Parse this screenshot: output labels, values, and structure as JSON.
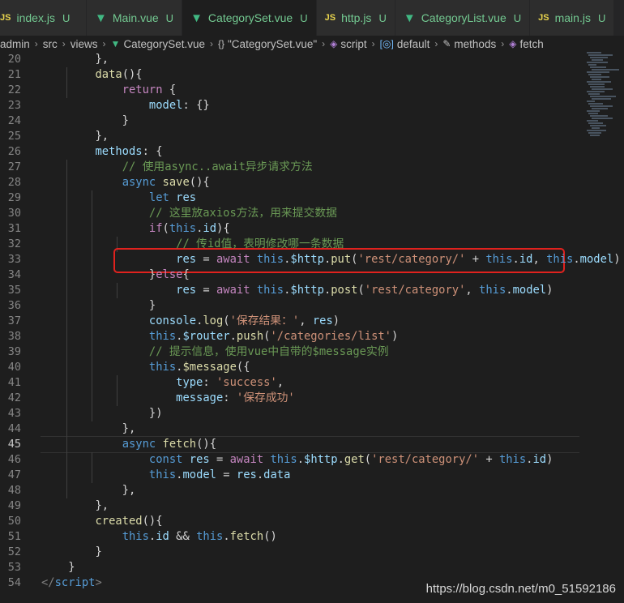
{
  "tabs": [
    {
      "icon": "JS",
      "icon_type": "js",
      "label": "index.js",
      "status": "U"
    },
    {
      "icon": "▼",
      "icon_type": "vue",
      "label": "Main.vue",
      "status": "U"
    },
    {
      "icon": "▼",
      "icon_type": "vue",
      "label": "CategorySet.vue",
      "status": "U",
      "active": true
    },
    {
      "icon": "JS",
      "icon_type": "js",
      "label": "http.js",
      "status": "U"
    },
    {
      "icon": "▼",
      "icon_type": "vue",
      "label": "CategoryList.vue",
      "status": "U"
    },
    {
      "icon": "JS",
      "icon_type": "js",
      "label": "main.js",
      "status": "U"
    }
  ],
  "breadcrumb": {
    "admin": "admin",
    "src": "src",
    "views": "views",
    "file": "CategorySet.vue",
    "component": "\"CategorySet.vue\"",
    "script": "script",
    "default": "default",
    "methods": "methods",
    "fetch": "fetch"
  },
  "current_line": 45,
  "lines": [
    {
      "n": "20",
      "tokens": [
        [
          "t-plain",
          "        },"
        ]
      ]
    },
    {
      "n": "21",
      "tokens": [
        [
          "t-plain",
          "        "
        ],
        [
          "t-fn",
          "data"
        ],
        [
          "t-plain",
          "(){"
        ]
      ]
    },
    {
      "n": "22",
      "tokens": [
        [
          "t-plain",
          "            "
        ],
        [
          "t-ctrl",
          "return"
        ],
        [
          "t-plain",
          " {"
        ]
      ]
    },
    {
      "n": "23",
      "tokens": [
        [
          "t-plain",
          "                "
        ],
        [
          "t-prop",
          "model"
        ],
        [
          "t-plain",
          ": {}"
        ]
      ]
    },
    {
      "n": "24",
      "tokens": [
        [
          "t-plain",
          "            }"
        ]
      ]
    },
    {
      "n": "25",
      "tokens": [
        [
          "t-plain",
          "        },"
        ]
      ]
    },
    {
      "n": "26",
      "tokens": [
        [
          "t-plain",
          "        "
        ],
        [
          "t-prop",
          "methods"
        ],
        [
          "t-plain",
          ": {"
        ]
      ]
    },
    {
      "n": "27",
      "tokens": [
        [
          "t-plain",
          "            "
        ],
        [
          "t-com",
          "// 使用async..await异步请求方法"
        ]
      ]
    },
    {
      "n": "28",
      "tokens": [
        [
          "t-plain",
          "            "
        ],
        [
          "t-kw",
          "async"
        ],
        [
          "t-plain",
          " "
        ],
        [
          "t-fn",
          "save"
        ],
        [
          "t-plain",
          "(){"
        ]
      ]
    },
    {
      "n": "29",
      "tokens": [
        [
          "t-plain",
          "                "
        ],
        [
          "t-kw",
          "let"
        ],
        [
          "t-plain",
          " "
        ],
        [
          "t-prop",
          "res"
        ]
      ]
    },
    {
      "n": "30",
      "tokens": [
        [
          "t-plain",
          "                "
        ],
        [
          "t-com",
          "// 这里放axios方法，用来提交数据"
        ]
      ]
    },
    {
      "n": "31",
      "tokens": [
        [
          "t-plain",
          "                "
        ],
        [
          "t-ctrl",
          "if"
        ],
        [
          "t-plain",
          "("
        ],
        [
          "t-kw",
          "this"
        ],
        [
          "t-plain",
          "."
        ],
        [
          "t-prop",
          "id"
        ],
        [
          "t-plain",
          "){"
        ]
      ]
    },
    {
      "n": "32",
      "tokens": [
        [
          "t-plain",
          "                    "
        ],
        [
          "t-com",
          "// 传id值，表明修改哪一条数据"
        ]
      ]
    },
    {
      "n": "33",
      "tokens": [
        [
          "t-plain",
          "                    "
        ],
        [
          "t-prop",
          "res"
        ],
        [
          "t-plain",
          " = "
        ],
        [
          "t-ctrl",
          "await"
        ],
        [
          "t-plain",
          " "
        ],
        [
          "t-kw",
          "this"
        ],
        [
          "t-plain",
          "."
        ],
        [
          "t-prop",
          "$http"
        ],
        [
          "t-plain",
          "."
        ],
        [
          "t-fn",
          "put"
        ],
        [
          "t-plain",
          "("
        ],
        [
          "t-str",
          "'rest/category/'"
        ],
        [
          "t-plain",
          " + "
        ],
        [
          "t-kw",
          "this"
        ],
        [
          "t-plain",
          "."
        ],
        [
          "t-prop",
          "id"
        ],
        [
          "t-plain",
          ", "
        ],
        [
          "t-kw",
          "this"
        ],
        [
          "t-plain",
          "."
        ],
        [
          "t-prop",
          "model"
        ],
        [
          "t-plain",
          ")"
        ]
      ]
    },
    {
      "n": "34",
      "tokens": [
        [
          "t-plain",
          "                }"
        ],
        [
          "t-ctrl",
          "else"
        ],
        [
          "t-plain",
          "{"
        ]
      ]
    },
    {
      "n": "35",
      "tokens": [
        [
          "t-plain",
          "                    "
        ],
        [
          "t-prop",
          "res"
        ],
        [
          "t-plain",
          " = "
        ],
        [
          "t-ctrl",
          "await"
        ],
        [
          "t-plain",
          " "
        ],
        [
          "t-kw",
          "this"
        ],
        [
          "t-plain",
          "."
        ],
        [
          "t-prop",
          "$http"
        ],
        [
          "t-plain",
          "."
        ],
        [
          "t-fn",
          "post"
        ],
        [
          "t-plain",
          "("
        ],
        [
          "t-str",
          "'rest/category'"
        ],
        [
          "t-plain",
          ", "
        ],
        [
          "t-kw",
          "this"
        ],
        [
          "t-plain",
          "."
        ],
        [
          "t-prop",
          "model"
        ],
        [
          "t-plain",
          ")"
        ]
      ]
    },
    {
      "n": "36",
      "tokens": [
        [
          "t-plain",
          "                }"
        ]
      ]
    },
    {
      "n": "37",
      "tokens": [
        [
          "t-plain",
          "                "
        ],
        [
          "t-prop",
          "console"
        ],
        [
          "t-plain",
          "."
        ],
        [
          "t-fn",
          "log"
        ],
        [
          "t-plain",
          "("
        ],
        [
          "t-str",
          "'保存结果：'"
        ],
        [
          "t-plain",
          ", "
        ],
        [
          "t-prop",
          "res"
        ],
        [
          "t-plain",
          ")"
        ]
      ]
    },
    {
      "n": "38",
      "tokens": [
        [
          "t-plain",
          "                "
        ],
        [
          "t-kw",
          "this"
        ],
        [
          "t-plain",
          "."
        ],
        [
          "t-prop",
          "$router"
        ],
        [
          "t-plain",
          "."
        ],
        [
          "t-fn",
          "push"
        ],
        [
          "t-plain",
          "("
        ],
        [
          "t-str",
          "'/categories/list'"
        ],
        [
          "t-plain",
          ")"
        ]
      ]
    },
    {
      "n": "39",
      "tokens": [
        [
          "t-plain",
          "                "
        ],
        [
          "t-com",
          "// 提示信息，使用vue中自带的$message实例"
        ]
      ]
    },
    {
      "n": "40",
      "tokens": [
        [
          "t-plain",
          "                "
        ],
        [
          "t-kw",
          "this"
        ],
        [
          "t-plain",
          "."
        ],
        [
          "t-fn",
          "$message"
        ],
        [
          "t-plain",
          "({"
        ]
      ]
    },
    {
      "n": "41",
      "tokens": [
        [
          "t-plain",
          "                    "
        ],
        [
          "t-prop",
          "type"
        ],
        [
          "t-plain",
          ": "
        ],
        [
          "t-str",
          "'success'"
        ],
        [
          "t-plain",
          ","
        ]
      ]
    },
    {
      "n": "42",
      "tokens": [
        [
          "t-plain",
          "                    "
        ],
        [
          "t-prop",
          "message"
        ],
        [
          "t-plain",
          ": "
        ],
        [
          "t-str",
          "'保存成功'"
        ]
      ]
    },
    {
      "n": "43",
      "tokens": [
        [
          "t-plain",
          "                })"
        ]
      ]
    },
    {
      "n": "44",
      "tokens": [
        [
          "t-plain",
          "            },"
        ]
      ]
    },
    {
      "n": "45",
      "tokens": [
        [
          "t-plain",
          "            "
        ],
        [
          "t-kw",
          "async"
        ],
        [
          "t-plain",
          " "
        ],
        [
          "t-fn",
          "fetch"
        ],
        [
          "t-plain",
          "(){"
        ]
      ]
    },
    {
      "n": "46",
      "tokens": [
        [
          "t-plain",
          "                "
        ],
        [
          "t-kw",
          "const"
        ],
        [
          "t-plain",
          " "
        ],
        [
          "t-prop",
          "res"
        ],
        [
          "t-plain",
          " = "
        ],
        [
          "t-ctrl",
          "await"
        ],
        [
          "t-plain",
          " "
        ],
        [
          "t-kw",
          "this"
        ],
        [
          "t-plain",
          "."
        ],
        [
          "t-prop",
          "$http"
        ],
        [
          "t-plain",
          "."
        ],
        [
          "t-fn",
          "get"
        ],
        [
          "t-plain",
          "("
        ],
        [
          "t-str",
          "'rest/category/'"
        ],
        [
          "t-plain",
          " + "
        ],
        [
          "t-kw",
          "this"
        ],
        [
          "t-plain",
          "."
        ],
        [
          "t-prop",
          "id"
        ],
        [
          "t-plain",
          ")"
        ]
      ]
    },
    {
      "n": "47",
      "tokens": [
        [
          "t-plain",
          "                "
        ],
        [
          "t-kw",
          "this"
        ],
        [
          "t-plain",
          "."
        ],
        [
          "t-prop",
          "model"
        ],
        [
          "t-plain",
          " = "
        ],
        [
          "t-prop",
          "res"
        ],
        [
          "t-plain",
          "."
        ],
        [
          "t-prop",
          "data"
        ]
      ]
    },
    {
      "n": "48",
      "tokens": [
        [
          "t-plain",
          "            },"
        ]
      ]
    },
    {
      "n": "49",
      "tokens": [
        [
          "t-plain",
          "        },"
        ]
      ]
    },
    {
      "n": "50",
      "tokens": [
        [
          "t-plain",
          "        "
        ],
        [
          "t-fn",
          "created"
        ],
        [
          "t-plain",
          "(){"
        ]
      ]
    },
    {
      "n": "51",
      "tokens": [
        [
          "t-plain",
          "            "
        ],
        [
          "t-kw",
          "this"
        ],
        [
          "t-plain",
          "."
        ],
        [
          "t-prop",
          "id"
        ],
        [
          "t-plain",
          " && "
        ],
        [
          "t-kw",
          "this"
        ],
        [
          "t-plain",
          "."
        ],
        [
          "t-fn",
          "fetch"
        ],
        [
          "t-plain",
          "()"
        ]
      ]
    },
    {
      "n": "52",
      "tokens": [
        [
          "t-plain",
          "        }"
        ]
      ]
    },
    {
      "n": "53",
      "tokens": [
        [
          "t-plain",
          "    }"
        ]
      ]
    },
    {
      "n": "54",
      "tokens": [
        [
          "t-tagb",
          "</"
        ],
        [
          "t-tag",
          "script"
        ],
        [
          "t-tagb",
          ">"
        ]
      ]
    }
  ],
  "watermark": "https://blog.csdn.net/m0_51592186",
  "colors": {
    "highlight_box": "#e0221e",
    "editor_bg": "#1e1e1e"
  }
}
